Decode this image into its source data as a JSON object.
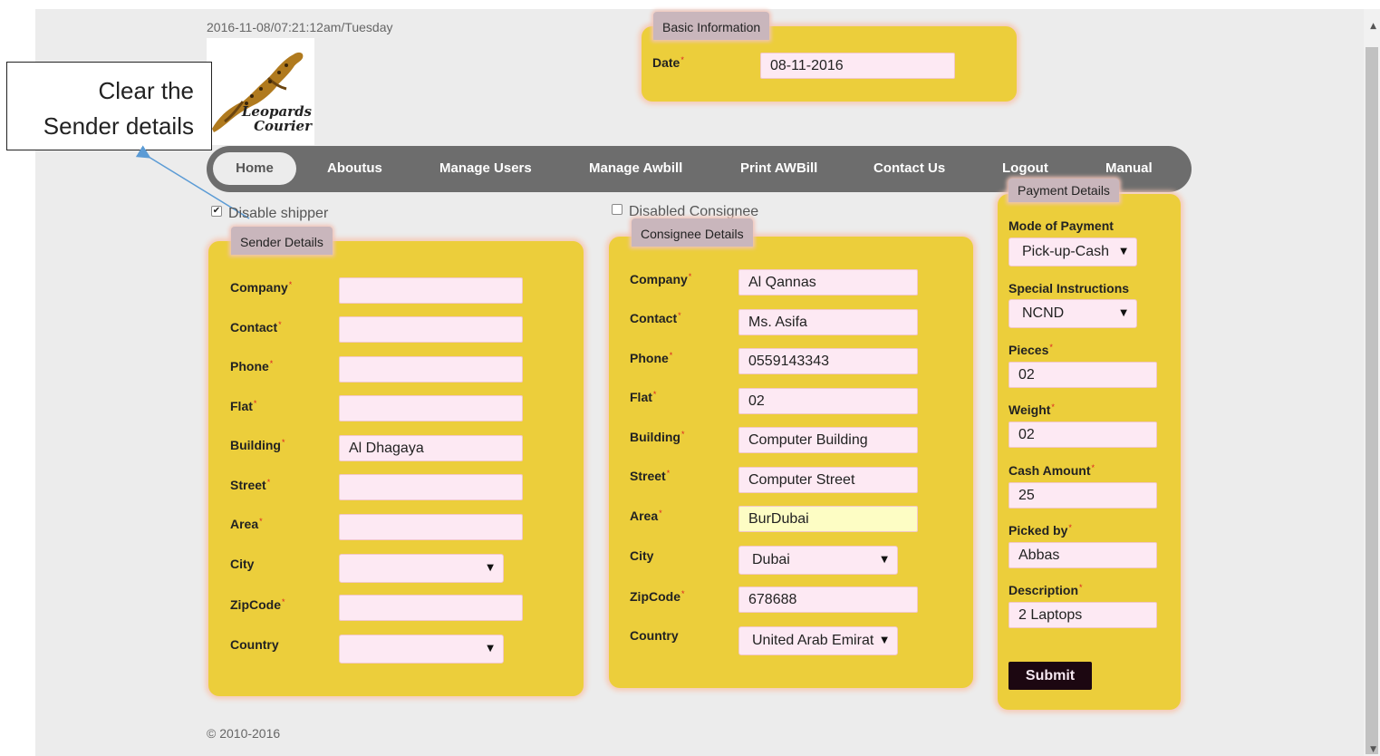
{
  "timestamp": "2016-11-08/07:21:12am/Tuesday",
  "logo": {
    "line1": "Leopards",
    "line2": "Courier"
  },
  "callout": {
    "line1": "Clear the",
    "line2": "Sender details"
  },
  "basic_info": {
    "legend": "Basic Information",
    "date_label": "Date",
    "date_value": "08-11-2016"
  },
  "nav": {
    "items": [
      "Home",
      "Aboutus",
      "Manage Users",
      "Manage Awbill",
      "Print AWBill",
      "Contact Us",
      "Logout",
      "Manual"
    ]
  },
  "toggles": {
    "disable_shipper": "Disable shipper",
    "disabled_consignee": "Disabled Consignee"
  },
  "sender": {
    "legend": "Sender Details",
    "company_label": "Company",
    "contact_label": "Contact",
    "phone_label": "Phone",
    "flat_label": "Flat",
    "building_label": "Building",
    "building_value": "Al Dhagaya",
    "street_label": "Street",
    "area_label": "Area",
    "city_label": "City",
    "zipcode_label": "ZipCode",
    "country_label": "Country"
  },
  "consignee": {
    "legend": "Consignee Details",
    "company_label": "Company",
    "company_value": "Al Qannas",
    "contact_label": "Contact",
    "contact_value": "Ms. Asifa",
    "phone_label": "Phone",
    "phone_value": "0559143343",
    "flat_label": "Flat",
    "flat_value": "02",
    "building_label": "Building",
    "building_value": "Computer Building",
    "street_label": "Street",
    "street_value": "Computer Street",
    "area_label": "Area",
    "area_value": "BurDubai",
    "city_label": "City",
    "city_value": "Dubai",
    "zipcode_label": "ZipCode",
    "zipcode_value": "678688",
    "country_label": "Country",
    "country_value": "United Arab Emirat"
  },
  "payment": {
    "legend": "Payment Details",
    "mode_label": "Mode of Payment",
    "mode_value": "Pick-up-Cash",
    "instructions_label": "Special Instructions",
    "instructions_value": "NCND",
    "pieces_label": "Pieces",
    "pieces_value": "02",
    "weight_label": "Weight",
    "weight_value": "02",
    "cash_label": "Cash Amount",
    "cash_value": "25",
    "picked_label": "Picked by",
    "picked_value": "Abbas",
    "description_label": "Description",
    "description_value": "2 Laptops",
    "submit_label": "Submit"
  },
  "footer": "© 2010-2016",
  "colors": {
    "panel": "#ecce3b",
    "legend": "#c9b6bc",
    "input": "#fde9f3",
    "nav": "#6d6d6d",
    "submit": "#1c0711",
    "required": "#dd2222"
  }
}
